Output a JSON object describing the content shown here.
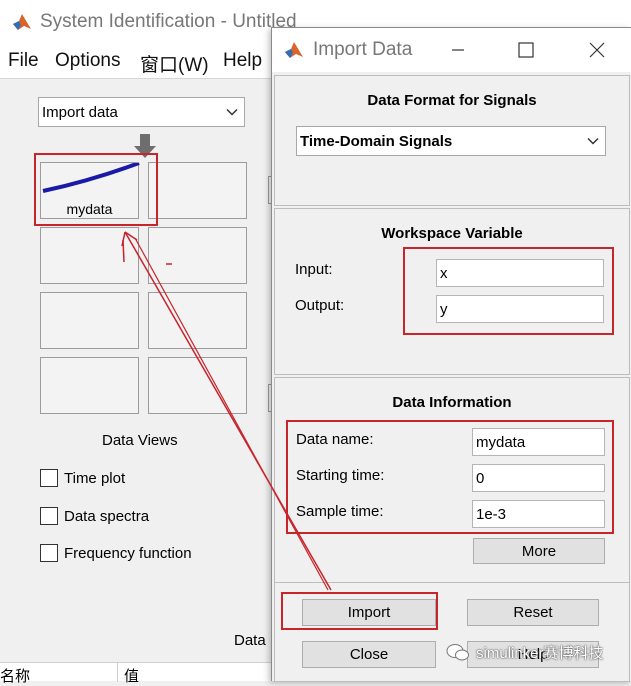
{
  "background_window": {
    "title": "System Identification - Untitled",
    "menu": [
      "File",
      "Options",
      "窗口(W)",
      "Help"
    ],
    "import_select": {
      "selected": "Import data"
    },
    "data_tile": {
      "label": "mydata",
      "line_color": "#1a1aa6"
    },
    "data_views_label": "Data Views",
    "checkboxes": [
      {
        "label": "Time plot",
        "checked": false
      },
      {
        "label": "Data spectra",
        "checked": false
      },
      {
        "label": "Frequency function",
        "checked": false
      }
    ],
    "partial_label": "Data",
    "table_headers": [
      "名称",
      "值"
    ]
  },
  "dialog": {
    "title": "Import Data",
    "data_format": {
      "heading": "Data Format for Signals",
      "selected": "Time-Domain Signals"
    },
    "workspace": {
      "heading": "Workspace Variable",
      "input_label": "Input:",
      "input_value": "x",
      "output_label": "Output:",
      "output_value": "y"
    },
    "info": {
      "heading": "Data Information",
      "name_label": "Data name:",
      "name_value": "mydata",
      "start_label": "Starting time:",
      "start_value": "0",
      "sample_label": "Sample time:",
      "sample_value": "1e-3",
      "more_label": "More"
    },
    "buttons": {
      "import": "Import",
      "reset": "Reset",
      "close": "Close",
      "help": "Help"
    }
  },
  "watermark": "simulinker赛博科技",
  "colors": {
    "annotation_red": "#c8242c",
    "data_line": "#1a1aa6"
  }
}
